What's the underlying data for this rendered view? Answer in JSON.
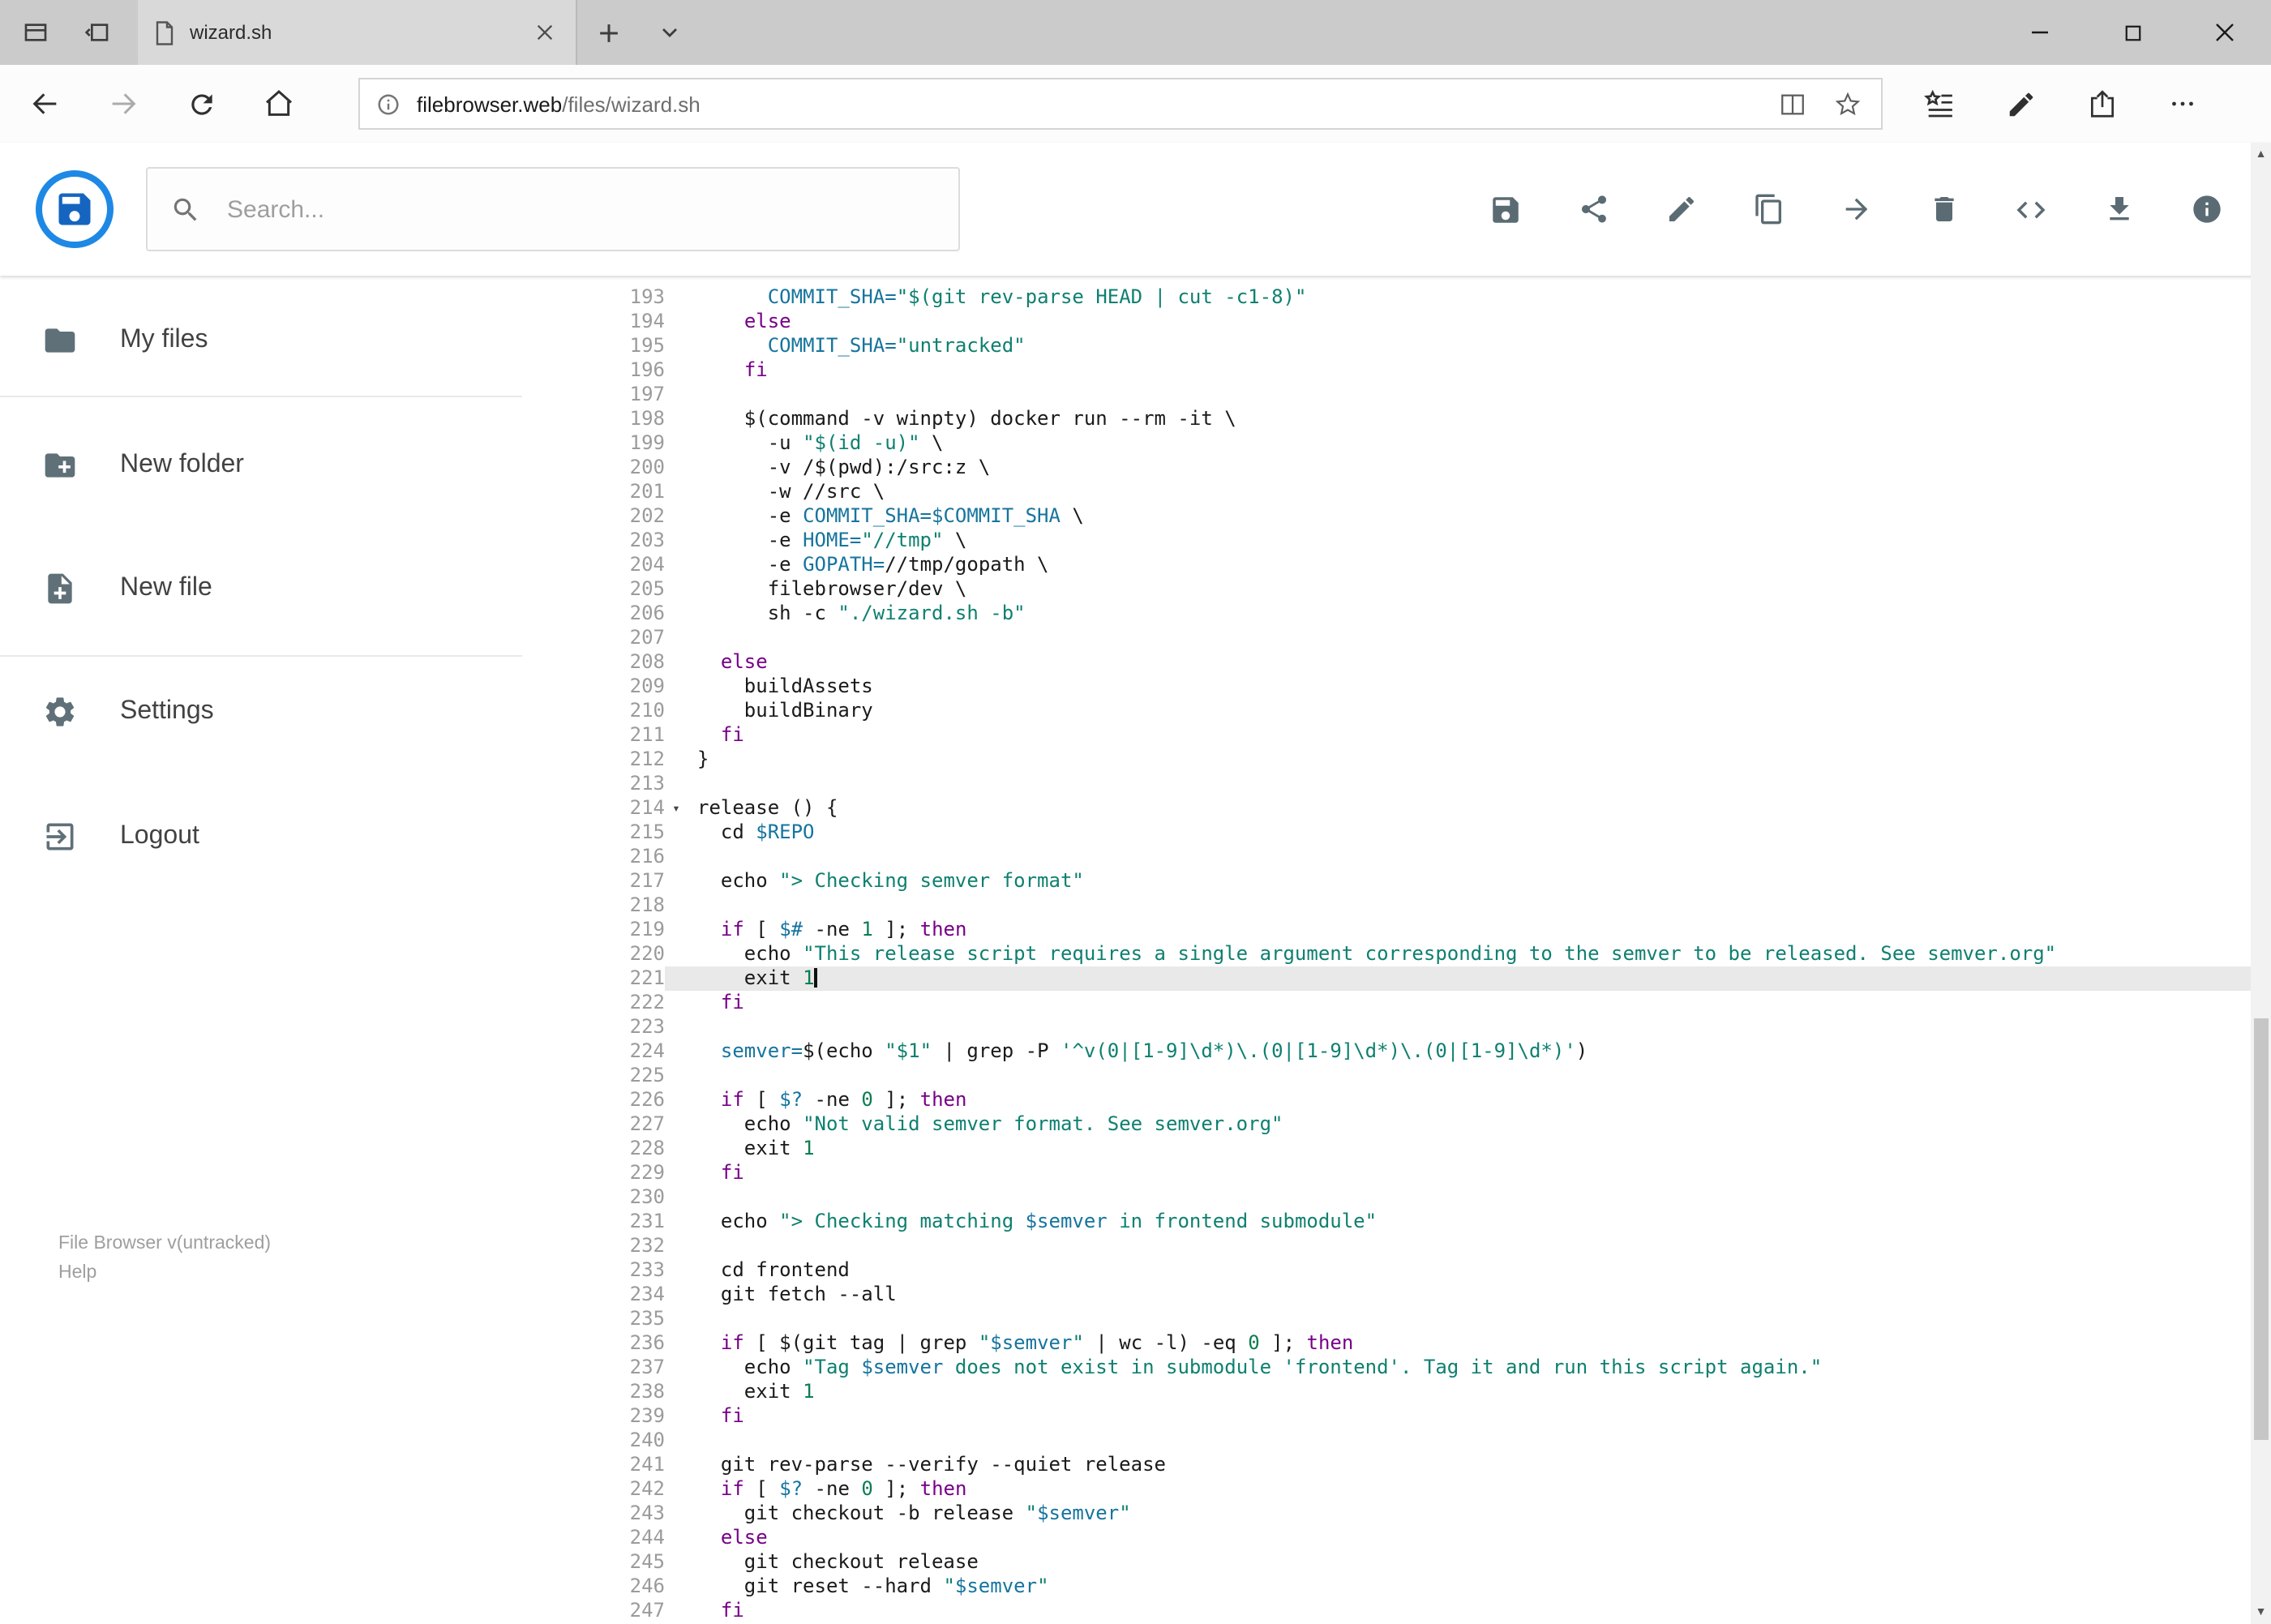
{
  "browser": {
    "tab_title": "wizard.sh",
    "url_host": "filebrowser.web",
    "url_path": "/files/wizard.sh"
  },
  "app": {
    "search_placeholder": "Search...",
    "toolbar_icons": [
      "save",
      "share",
      "rename",
      "copy",
      "move",
      "delete",
      "raw",
      "download",
      "info"
    ],
    "sidebar": {
      "items": [
        {
          "label": "My files",
          "icon": "folder-icon"
        },
        {
          "label": "New folder",
          "icon": "new-folder-icon"
        },
        {
          "label": "New file",
          "icon": "new-file-icon"
        },
        {
          "label": "Settings",
          "icon": "settings-icon"
        },
        {
          "label": "Logout",
          "icon": "logout-icon"
        }
      ],
      "footer_version": "File Browser v(untracked)",
      "footer_help": "Help"
    }
  },
  "editor": {
    "active_line": 221,
    "fold_line": 214,
    "cursor": true,
    "lines": [
      {
        "n": 193,
        "seg": [
          [
            "p",
            "      "
          ],
          [
            "v",
            "COMMIT_SHA="
          ],
          [
            "s",
            "\"$(git rev-parse HEAD | cut -c1-8)\""
          ]
        ]
      },
      {
        "n": 194,
        "seg": [
          [
            "p",
            "    "
          ],
          [
            "k",
            "else"
          ]
        ]
      },
      {
        "n": 195,
        "seg": [
          [
            "p",
            "      "
          ],
          [
            "v",
            "COMMIT_SHA="
          ],
          [
            "s",
            "\"untracked\""
          ]
        ]
      },
      {
        "n": 196,
        "seg": [
          [
            "p",
            "    "
          ],
          [
            "k",
            "fi"
          ]
        ]
      },
      {
        "n": 197,
        "seg": []
      },
      {
        "n": 198,
        "seg": [
          [
            "p",
            "    $(command -v winpty) docker run --rm -it \\"
          ]
        ]
      },
      {
        "n": 199,
        "seg": [
          [
            "p",
            "      -u "
          ],
          [
            "s",
            "\"$(id -u)\""
          ],
          [
            "p",
            " \\"
          ]
        ]
      },
      {
        "n": 200,
        "seg": [
          [
            "p",
            "      -v /$(pwd):/src:z \\"
          ]
        ]
      },
      {
        "n": 201,
        "seg": [
          [
            "p",
            "      -w //src \\"
          ]
        ]
      },
      {
        "n": 202,
        "seg": [
          [
            "p",
            "      -e "
          ],
          [
            "v",
            "COMMIT_SHA=$COMMIT_SHA"
          ],
          [
            "p",
            " \\"
          ]
        ]
      },
      {
        "n": 203,
        "seg": [
          [
            "p",
            "      -e "
          ],
          [
            "v",
            "HOME="
          ],
          [
            "s",
            "\"//tmp\""
          ],
          [
            "p",
            " \\"
          ]
        ]
      },
      {
        "n": 204,
        "seg": [
          [
            "p",
            "      -e "
          ],
          [
            "v",
            "GOPATH="
          ],
          [
            "p",
            "//tmp/gopath \\"
          ]
        ]
      },
      {
        "n": 205,
        "seg": [
          [
            "p",
            "      filebrowser/dev \\"
          ]
        ]
      },
      {
        "n": 206,
        "seg": [
          [
            "p",
            "      sh -c "
          ],
          [
            "s",
            "\"./wizard.sh -b\""
          ]
        ]
      },
      {
        "n": 207,
        "seg": []
      },
      {
        "n": 208,
        "seg": [
          [
            "p",
            "  "
          ],
          [
            "k",
            "else"
          ]
        ]
      },
      {
        "n": 209,
        "seg": [
          [
            "p",
            "    buildAssets"
          ]
        ]
      },
      {
        "n": 210,
        "seg": [
          [
            "p",
            "    buildBinary"
          ]
        ]
      },
      {
        "n": 211,
        "seg": [
          [
            "p",
            "  "
          ],
          [
            "k",
            "fi"
          ]
        ]
      },
      {
        "n": 212,
        "seg": [
          [
            "p",
            "}"
          ]
        ]
      },
      {
        "n": 213,
        "seg": []
      },
      {
        "n": 214,
        "seg": [
          [
            "p",
            "release () {"
          ]
        ]
      },
      {
        "n": 215,
        "seg": [
          [
            "p",
            "  cd "
          ],
          [
            "v",
            "$REPO"
          ]
        ]
      },
      {
        "n": 216,
        "seg": []
      },
      {
        "n": 217,
        "seg": [
          [
            "p",
            "  echo "
          ],
          [
            "s",
            "\"> Checking semver format\""
          ]
        ]
      },
      {
        "n": 218,
        "seg": []
      },
      {
        "n": 219,
        "seg": [
          [
            "p",
            "  "
          ],
          [
            "k",
            "if"
          ],
          [
            "p",
            " [ "
          ],
          [
            "v",
            "$#"
          ],
          [
            "p",
            " -ne "
          ],
          [
            "n",
            "1"
          ],
          [
            "p",
            " ]; "
          ],
          [
            "k",
            "then"
          ]
        ]
      },
      {
        "n": 220,
        "seg": [
          [
            "p",
            "    echo "
          ],
          [
            "s",
            "\"This release script requires a single argument corresponding to the semver to be released. See semver.org\""
          ]
        ]
      },
      {
        "n": 221,
        "seg": [
          [
            "p",
            "    exit "
          ],
          [
            "n",
            "1"
          ]
        ]
      },
      {
        "n": 222,
        "seg": [
          [
            "p",
            "  "
          ],
          [
            "k",
            "fi"
          ]
        ]
      },
      {
        "n": 223,
        "seg": []
      },
      {
        "n": 224,
        "seg": [
          [
            "p",
            "  "
          ],
          [
            "v",
            "semver="
          ],
          [
            "p",
            "$(echo "
          ],
          [
            "s",
            "\"$1\""
          ],
          [
            "p",
            " | grep -P "
          ],
          [
            "s",
            "'^v(0|[1-9]\\d*)\\.(0|[1-9]\\d*)\\.(0|[1-9]\\d*)'"
          ],
          [
            "p",
            ")"
          ]
        ]
      },
      {
        "n": 225,
        "seg": []
      },
      {
        "n": 226,
        "seg": [
          [
            "p",
            "  "
          ],
          [
            "k",
            "if"
          ],
          [
            "p",
            " [ "
          ],
          [
            "v",
            "$?"
          ],
          [
            "p",
            " -ne "
          ],
          [
            "n",
            "0"
          ],
          [
            "p",
            " ]; "
          ],
          [
            "k",
            "then"
          ]
        ]
      },
      {
        "n": 227,
        "seg": [
          [
            "p",
            "    echo "
          ],
          [
            "s",
            "\"Not valid semver format. See semver.org\""
          ]
        ]
      },
      {
        "n": 228,
        "seg": [
          [
            "p",
            "    exit "
          ],
          [
            "n",
            "1"
          ]
        ]
      },
      {
        "n": 229,
        "seg": [
          [
            "p",
            "  "
          ],
          [
            "k",
            "fi"
          ]
        ]
      },
      {
        "n": 230,
        "seg": []
      },
      {
        "n": 231,
        "seg": [
          [
            "p",
            "  echo "
          ],
          [
            "s",
            "\"> Checking matching "
          ],
          [
            "v",
            "$semver"
          ],
          [
            "s",
            " in frontend submodule\""
          ]
        ]
      },
      {
        "n": 232,
        "seg": []
      },
      {
        "n": 233,
        "seg": [
          [
            "p",
            "  cd frontend"
          ]
        ]
      },
      {
        "n": 234,
        "seg": [
          [
            "p",
            "  git fetch --all"
          ]
        ]
      },
      {
        "n": 235,
        "seg": []
      },
      {
        "n": 236,
        "seg": [
          [
            "p",
            "  "
          ],
          [
            "k",
            "if"
          ],
          [
            "p",
            " [ $(git tag | grep "
          ],
          [
            "s",
            "\""
          ],
          [
            "v",
            "$semver"
          ],
          [
            "s",
            "\""
          ],
          [
            "p",
            " | wc -l) -eq "
          ],
          [
            "n",
            "0"
          ],
          [
            "p",
            " ]; "
          ],
          [
            "k",
            "then"
          ]
        ]
      },
      {
        "n": 237,
        "seg": [
          [
            "p",
            "    echo "
          ],
          [
            "s",
            "\"Tag "
          ],
          [
            "v",
            "$semver"
          ],
          [
            "s",
            " does not exist in submodule 'frontend'. Tag it and run this script again.\""
          ]
        ]
      },
      {
        "n": 238,
        "seg": [
          [
            "p",
            "    exit "
          ],
          [
            "n",
            "1"
          ]
        ]
      },
      {
        "n": 239,
        "seg": [
          [
            "p",
            "  "
          ],
          [
            "k",
            "fi"
          ]
        ]
      },
      {
        "n": 240,
        "seg": []
      },
      {
        "n": 241,
        "seg": [
          [
            "p",
            "  git rev-parse --verify --quiet release"
          ]
        ]
      },
      {
        "n": 242,
        "seg": [
          [
            "p",
            "  "
          ],
          [
            "k",
            "if"
          ],
          [
            "p",
            " [ "
          ],
          [
            "v",
            "$?"
          ],
          [
            "p",
            " -ne "
          ],
          [
            "n",
            "0"
          ],
          [
            "p",
            " ]; "
          ],
          [
            "k",
            "then"
          ]
        ]
      },
      {
        "n": 243,
        "seg": [
          [
            "p",
            "    git checkout -b release "
          ],
          [
            "s",
            "\""
          ],
          [
            "v",
            "$semver"
          ],
          [
            "s",
            "\""
          ]
        ]
      },
      {
        "n": 244,
        "seg": [
          [
            "p",
            "  "
          ],
          [
            "k",
            "else"
          ]
        ]
      },
      {
        "n": 245,
        "seg": [
          [
            "p",
            "    git checkout release"
          ]
        ]
      },
      {
        "n": 246,
        "seg": [
          [
            "p",
            "    git reset --hard "
          ],
          [
            "s",
            "\""
          ],
          [
            "v",
            "$semver"
          ],
          [
            "s",
            "\""
          ]
        ]
      },
      {
        "n": 247,
        "seg": [
          [
            "p",
            "  "
          ],
          [
            "k",
            "fi"
          ]
        ]
      }
    ]
  },
  "colors": {
    "keyword": "#770088",
    "string": "#0f8070",
    "variable": "#16749e",
    "number": "#0d7d52",
    "accent_blue": "#1e88e5"
  }
}
